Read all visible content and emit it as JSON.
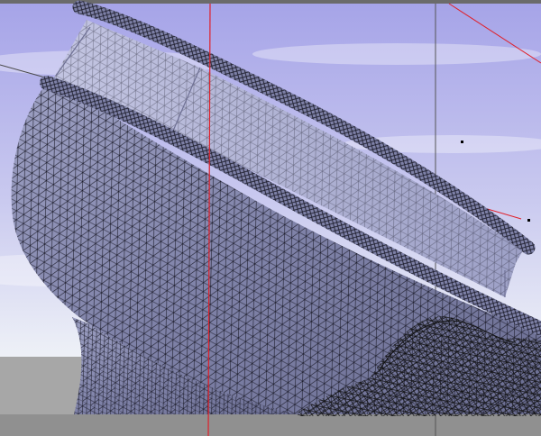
{
  "viewport": {
    "type": "3d-wireframe-viewport",
    "colors": {
      "sky_top": "#a6a4e8",
      "sky_bottom": "#e9ecf6",
      "ground": "#a7a7a7",
      "hull_fill": "#8a8db2",
      "wire": "#1a1a28",
      "guide_red": "#e0202a",
      "guide_gray": "#4a4a4a"
    }
  }
}
